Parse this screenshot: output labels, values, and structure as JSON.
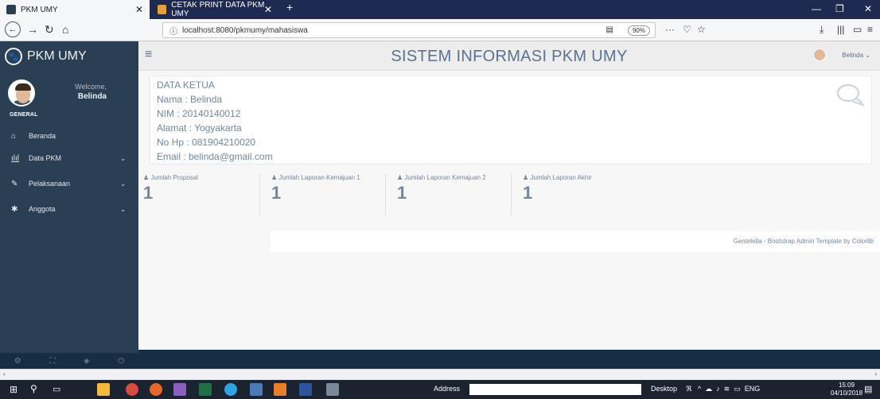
{
  "browser": {
    "tabs": [
      {
        "label": "PKM UMY"
      },
      {
        "label": "CETAK PRINT DATA PKM UMY"
      }
    ],
    "url": "localhost:8080/pkmumy/mahasiswa",
    "zoom": "90%"
  },
  "sidebar": {
    "brand": "PKM UMY",
    "welcome": "Welcome,",
    "user": "Belinda",
    "section": "GENERAL",
    "items": [
      {
        "label": "Beranda",
        "icon": "home-icon"
      },
      {
        "label": "Data PKM",
        "icon": "bar-chart-icon"
      },
      {
        "label": "Pelaksanaan",
        "icon": "edit-icon"
      },
      {
        "label": "Anggota",
        "icon": "group-icon"
      }
    ]
  },
  "header": {
    "title": "SISTEM INFORMASI PKM UMY",
    "user": "Belinda"
  },
  "ketua": {
    "heading": "DATA KETUA",
    "nama": "Nama : Belinda",
    "nim": "NIM : 20140140012",
    "alamat": "Alamat : Yogyakarta",
    "hp": "No Hp : 081904210020",
    "email": "Email : belinda@gmail.com"
  },
  "stats": [
    {
      "label": "Jumlah Proposal",
      "value": "1"
    },
    {
      "label": "Jumlah Laporan Kemajuan 1",
      "value": "1"
    },
    {
      "label": "Jumlah Laporan Kemajuan 2",
      "value": "1"
    },
    {
      "label": "Jumlah Laporan Akhir",
      "value": "1"
    }
  ],
  "footer": "Gentelella - Bootstrap Admin Template by Colorlib",
  "taskbar": {
    "address_label": "Address",
    "desktop_label": "Desktop",
    "lang": "ENG",
    "time": "15:09",
    "date": "04/10/2018"
  },
  "colors": {
    "sidebar": "#2a3f54",
    "tabbar": "#1f2a52",
    "text": "#73879c"
  }
}
